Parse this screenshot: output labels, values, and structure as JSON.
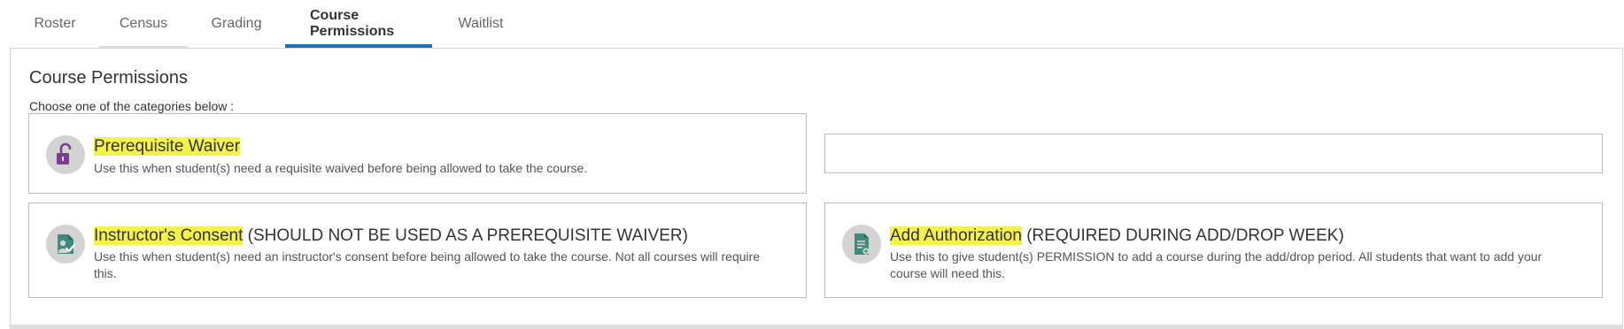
{
  "tabs": [
    {
      "label": "Roster"
    },
    {
      "label": "Census"
    },
    {
      "label": "Grading"
    },
    {
      "label": "Course Permissions"
    },
    {
      "label": "Waitlist"
    }
  ],
  "active_tab": "Course Permissions",
  "panel": {
    "title": "Course Permissions",
    "subtitle": "Choose one of the categories below :"
  },
  "cards": {
    "prerequisite_waiver": {
      "title": "Prerequisite Waiver",
      "title_suffix": "",
      "description": "Use this when student(s) need a requisite waived before being allowed to take the course.",
      "icon": "unlocked-padlock-icon"
    },
    "instructors_consent": {
      "title": "Instructor's Consent",
      "title_suffix": " (SHOULD NOT BE USED AS A PREREQUISITE WAIVER)",
      "description": "Use this when student(s) need an instructor's consent before being allowed to take the course. Not all courses will require this.",
      "icon": "person-check-icon"
    },
    "add_authorization": {
      "title": "Add Authorization",
      "title_suffix": " (REQUIRED DURING ADD/DROP WEEK)",
      "description": "Use this to give student(s) PERMISSION to add a course during the add/drop period. All students that want to add your course will need this.",
      "icon": "document-add-icon"
    }
  },
  "colors": {
    "active_tab_underline": "#1f6fbf",
    "highlight": "#f2f24a",
    "padlock_purple": "#7b3d91",
    "teal_icon": "#3e8a7c",
    "icon_circle": "#d3d3d3"
  }
}
